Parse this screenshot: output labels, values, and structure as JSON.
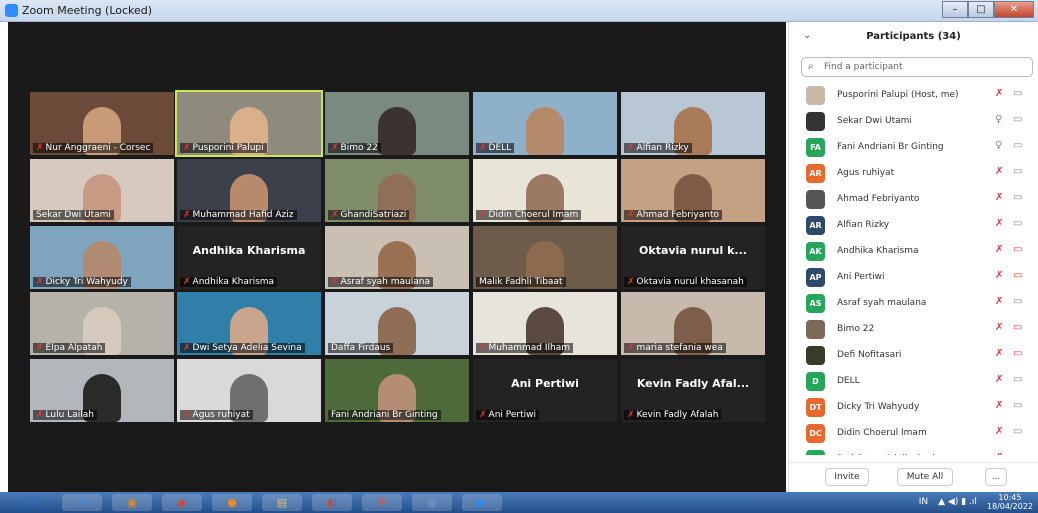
{
  "window": {
    "title": "Zoom Meeting (Locked)",
    "min": "–",
    "max": "□",
    "close": "✕"
  },
  "tiles": [
    {
      "name": "Nur Anggraeni - Corsec",
      "muted": true,
      "bg": "#6b4a3a",
      "skin": "#c89a78"
    },
    {
      "name": "Pusporini Palupi",
      "muted": true,
      "bg": "#8e8a7c",
      "skin": "#d9b089",
      "active": true
    },
    {
      "name": "Bimo 22",
      "muted": true,
      "bg": "#7a8a80",
      "skin": "#3a3330"
    },
    {
      "name": "DELL",
      "muted": true,
      "bg": "#8fb0c9",
      "skin": "#b58a6a"
    },
    {
      "name": "Alfian Rizky",
      "muted": true,
      "bg": "#b9c7d4",
      "skin": "#a97b5b"
    },
    {
      "name": "Sekar Dwi Utami",
      "muted": false,
      "bg": "#d7c9bd",
      "skin": "#c79b83"
    },
    {
      "name": "Muhammad Hafid Aziz",
      "muted": true,
      "bg": "#3b3f4a",
      "skin": "#b8896b"
    },
    {
      "name": "GhandiSatriazi",
      "muted": true,
      "bg": "#7e8c6a",
      "skin": "#8f6f57"
    },
    {
      "name": "Didin Choerul Imam",
      "muted": true,
      "bg": "#e8e4d6",
      "skin": "#9a7a62"
    },
    {
      "name": "Ahmad Febriyanto",
      "muted": true,
      "bg": "#c5a184",
      "skin": "#7e5b45"
    },
    {
      "name": "Dicky Tri Wahyudy",
      "muted": true,
      "bg": "#7fa4bd",
      "skin": "#b08a72"
    },
    {
      "name": "Andhika Kharisma",
      "muted": true,
      "bg": "",
      "skin": "",
      "big": "Andhika Kharisma"
    },
    {
      "name": "Asraf syah maulana",
      "muted": true,
      "bg": "#c9bfb3",
      "skin": "#9a7052"
    },
    {
      "name": "Malik Fadhli Tibaat",
      "muted": false,
      "bg": "#6d5c4a",
      "skin": "#8c6a50"
    },
    {
      "name": "Oktavia nurul khasanah",
      "muted": true,
      "bg": "",
      "skin": "",
      "big": "Oktavia nurul k..."
    },
    {
      "name": "Elpa Alpatah",
      "muted": true,
      "bg": "#b7b2a9",
      "skin": "#d6c9bd"
    },
    {
      "name": "Dwi Setya Adelia Sevina",
      "muted": true,
      "bg": "#2f7fa8",
      "skin": "#caa58d"
    },
    {
      "name": "Daffa Firdaus",
      "muted": false,
      "bg": "#c9d2d9",
      "skin": "#8f6d56"
    },
    {
      "name": "Muhammad Ilham",
      "muted": true,
      "bg": "#e7e4dc",
      "skin": "#5a4a40"
    },
    {
      "name": "maria stefania wea",
      "muted": true,
      "bg": "#c8b9ad",
      "skin": "#7d5e49"
    },
    {
      "name": "Lulu Lailah",
      "muted": true,
      "bg": "#b3b7bb",
      "skin": "#2a2a2a"
    },
    {
      "name": "Agus ruhiyat",
      "muted": true,
      "bg": "#d9d9d9",
      "skin": "#6f6f6f"
    },
    {
      "name": "Fani Andriani Br Ginting",
      "muted": false,
      "bg": "#4f6a3a",
      "skin": "#b48d74"
    },
    {
      "name": "Ani Pertiwi",
      "muted": true,
      "bg": "",
      "skin": "",
      "big": "Ani Pertiwi"
    },
    {
      "name": "Kevin Fadly Afalah",
      "muted": true,
      "bg": "",
      "skin": "",
      "big": "Kevin Fadly Afal..."
    }
  ],
  "panel": {
    "title": "Participants (34)",
    "chevron": "⌄",
    "search_placeholder": "Find a participant",
    "participants": [
      {
        "name": "Pusporini Palupi (Host, me)",
        "avatar": "",
        "color": "#c9b8a8",
        "mic": "off",
        "cam": "on"
      },
      {
        "name": "Sekar Dwi Utami",
        "avatar": "",
        "color": "#333333",
        "mic": "on",
        "cam": "on"
      },
      {
        "name": "Fani Andriani Br Ginting",
        "avatar": "FA",
        "color": "#26a65b",
        "mic": "on",
        "cam": "on"
      },
      {
        "name": "Agus ruhiyat",
        "avatar": "AR",
        "color": "#e8692b",
        "mic": "off",
        "cam": "on"
      },
      {
        "name": "Ahmad Febriyanto",
        "avatar": "",
        "color": "#555555",
        "mic": "off",
        "cam": "on"
      },
      {
        "name": "Alfian Rizky",
        "avatar": "AR",
        "color": "#2e4a6b",
        "mic": "off",
        "cam": "on"
      },
      {
        "name": "Andhika Kharisma",
        "avatar": "AK",
        "color": "#26a65b",
        "mic": "off",
        "cam": "off"
      },
      {
        "name": "Ani Pertiwi",
        "avatar": "AP",
        "color": "#2e4a6b",
        "mic": "off",
        "cam": "off"
      },
      {
        "name": "Asraf syah maulana",
        "avatar": "AS",
        "color": "#26a65b",
        "mic": "off",
        "cam": "on"
      },
      {
        "name": "Bimo 22",
        "avatar": "",
        "color": "#7a6a5a",
        "mic": "off",
        "cam": "off"
      },
      {
        "name": "Defi Nofitasari",
        "avatar": "",
        "color": "#3a3a2a",
        "mic": "off",
        "cam": "off"
      },
      {
        "name": "DELL",
        "avatar": "D",
        "color": "#26a65b",
        "mic": "off",
        "cam": "on"
      },
      {
        "name": "Dicky Tri Wahyudy",
        "avatar": "DT",
        "color": "#e8692b",
        "mic": "off",
        "cam": "on"
      },
      {
        "name": "Didin Choerul Imam",
        "avatar": "DC",
        "color": "#e8692b",
        "mic": "off",
        "cam": "on"
      },
      {
        "name": "Dwi Setya Adelia Sevina",
        "avatar": "DS",
        "color": "#26a65b",
        "mic": "off",
        "cam": "on"
      }
    ],
    "invite": "Invite",
    "mute_all": "Mute All",
    "more": "..."
  },
  "taskbar": {
    "apps": [
      "⊞",
      "e",
      "▣",
      "◉",
      "●",
      "▤",
      "◐",
      "P",
      "◍",
      "▶"
    ],
    "lang": "IN",
    "tray": "▲ ◀) ▮ .ıl",
    "time": "10:45",
    "date": "18/04/2022"
  }
}
